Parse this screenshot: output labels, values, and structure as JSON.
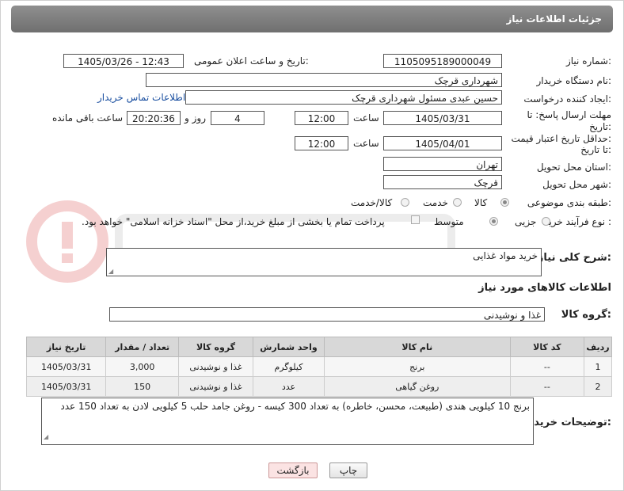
{
  "header": {
    "title": "جزئیات اطلاعات نیاز"
  },
  "form": {
    "need_number_label": "شماره نیاز:",
    "need_number": "1105095189000049",
    "announce_label": "تاریخ و ساعت اعلان عمومی:",
    "announce_value": "1405/03/26 - 12:43",
    "buyer_org_label": "نام دستگاه خریدار:",
    "buyer_org": "شهرداری قرچک",
    "creator_label": "ایجاد کننده درخواست:",
    "creator": "حسین عبدی مسئول شهرداری قرچک",
    "contact_link": "اطلاعات تماس خریدار",
    "reply_deadline_label_1": "مهلت ارسال پاسخ: تا",
    "reply_deadline_label_2": "تاریخ:",
    "reply_date": "1405/03/31",
    "time_label": "ساعت",
    "reply_time": "12:00",
    "days_value": "4",
    "days_label": "روز و",
    "remaining_time": "20:20:36",
    "remaining_label": "ساعت باقی مانده",
    "price_deadline_label_1": "حداقل تاریخ اعتبار قیمت:",
    "price_deadline_label_2": "تا تاریخ:",
    "price_date": "1405/04/01",
    "price_time": "12:00",
    "province_label": "استان محل تحویل:",
    "province": "تهران",
    "city_label": "شهر محل تحویل:",
    "city": "قرچک",
    "category_label": "طبقه بندی موضوعی:",
    "category_options": [
      "کالا",
      "خدمت",
      "کالا/خدمت"
    ],
    "category_selected": "کالا",
    "process_label": "نوع فرآیند خرید :",
    "process_options": [
      "جزیی",
      "متوسط"
    ],
    "process_selected": "متوسط",
    "payment_note": "پرداخت تمام یا بخشی از مبلغ خرید،از محل \"اسناد خزانه اسلامی\" خواهد بود.",
    "general_desc_label": "شرح کلی نیاز:",
    "general_desc": "خرید مواد غذایی",
    "goods_info_title": "اطلاعات کالاهای مورد نیاز",
    "goods_group_label": "گروه کالا:",
    "goods_group": "غذا و نوشیدنی",
    "buyer_notes_label": "توضیحات خریدار:",
    "buyer_notes": "برنج 10 کیلویی هندی (طبیعت، محسن، خاطره) به تعداد 300 کیسه - روغن جامد حلب 5 کیلویی لادن به تعداد 150 عدد"
  },
  "table": {
    "headers": [
      "ردیف",
      "کد کالا",
      "نام کالا",
      "واحد شمارش",
      "گروه کالا",
      "تعداد / مقدار",
      "تاریخ نیاز"
    ],
    "rows": [
      [
        "1",
        "--",
        "برنج",
        "کیلوگرم",
        "غذا و نوشیدنی",
        "3,000",
        "1405/03/31"
      ],
      [
        "2",
        "--",
        "روغن گیاهی",
        "عدد",
        "غذا و نوشیدنی",
        "150",
        "1405/03/31"
      ]
    ]
  },
  "buttons": {
    "print": "چاپ",
    "back": "بازگشت"
  },
  "colors": {
    "title_bar": "#7a7a7a",
    "link": "#1a4fa0",
    "back_button": "#fbe3e3"
  }
}
